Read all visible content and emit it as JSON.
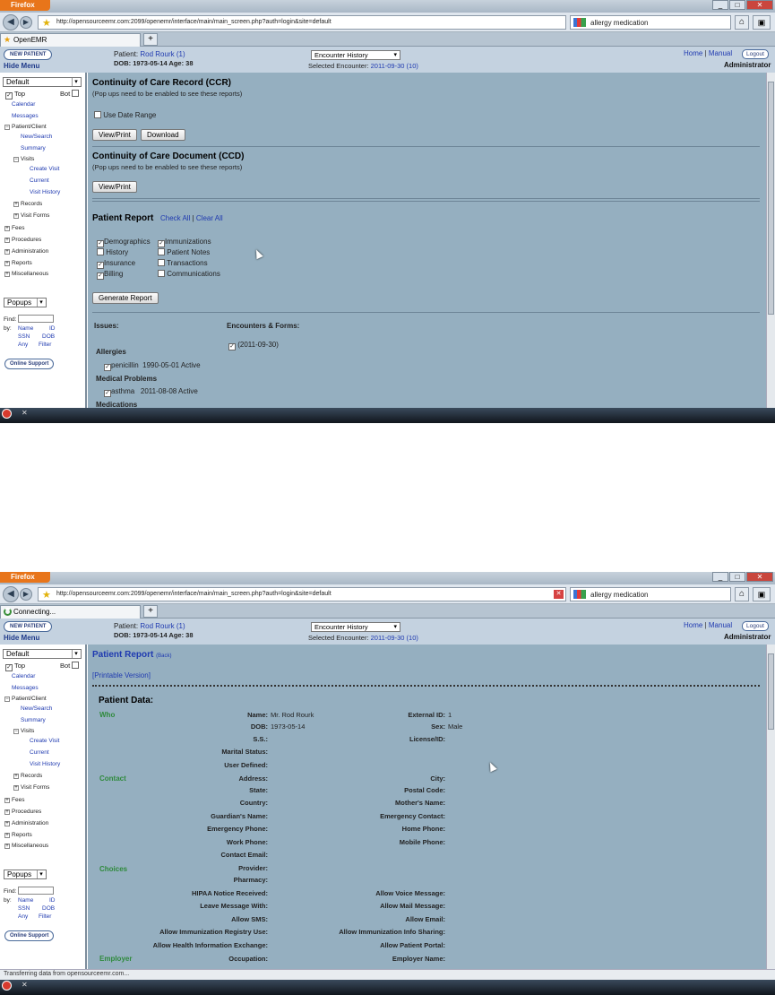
{
  "browser": {
    "menu_label": "Firefox",
    "url": "http://opensourceemr.com:2099/openemr/interface/main/main_screen.php?auth=login&site=default",
    "search_text": "allergy medication",
    "tab_label_1": "OpenEMR",
    "tab_label_2": "Connecting...",
    "new_tab": "+",
    "win_min": "_",
    "win_max": "□",
    "win_close": "✕",
    "status_text": "Transferring data from opensourceemr.com..."
  },
  "header": {
    "new_patient": "NEW PATIENT",
    "hide_menu": "Hide Menu",
    "patient_label": "Patient:",
    "patient_name": "Rod Rourk (1)",
    "dob_line": "DOB: 1973-05-14 Age: 38",
    "encounter_history": "Encounter History",
    "selected_encounter_label": "Selected Encounter:",
    "selected_encounter": "2011-09-30 (10)",
    "home": "Home",
    "manual": "Manual",
    "sep": "|",
    "logout": "Logout",
    "user": "Administrator"
  },
  "sidebar": {
    "select_default": "Default",
    "top": "Top",
    "bot": "Bot",
    "calendar": "Calendar",
    "messages": "Messages",
    "patient_client": "Patient/Client",
    "new_search": "New/Search",
    "summary": "Summary",
    "visits": "Visits",
    "create_visit": "Create Visit",
    "current": "Current",
    "visit_history": "Visit History",
    "records": "Records",
    "visit_forms": "Visit Forms",
    "fees": "Fees",
    "procedures": "Procedures",
    "administration": "Administration",
    "reports": "Reports",
    "miscellaneous": "Miscellaneous",
    "popups": "Popups",
    "find": "Find:",
    "by": "by:",
    "name": "Name",
    "id": "ID",
    "ssn": "SSN",
    "dob": "DOB",
    "any": "Any",
    "filter": "Filter",
    "online_support": "Online Support"
  },
  "reports_page": {
    "ccr_title": "Continuity of Care Record (CCR)",
    "ccr_note": "(Pop ups need to be enabled to see these reports)",
    "use_date_range": "Use Date Range",
    "view_print": "View/Print",
    "download": "Download",
    "ccd_title": "Continuity of Care Document (CCD)",
    "ccd_note": "(Pop ups need to be enabled to see these reports)",
    "patient_report": "Patient Report",
    "check_all": "Check All",
    "clear_all": "Clear All",
    "opts": {
      "demographics": "Demographics",
      "immunizations": "Immunizations",
      "history": "History",
      "patient_notes": "Patient Notes",
      "insurance": "Insurance",
      "transactions": "Transactions",
      "billing": "Billing",
      "communications": "Communications"
    },
    "generate_report": "Generate Report",
    "issues": "Issues:",
    "encounters_forms": "Encounters & Forms:",
    "encounter_item": "(2011-09-30)",
    "allergies": "Allergies",
    "allergy_item": "penicillin",
    "allergy_date": "1990-05-01 Active",
    "medical_problems": "Medical Problems",
    "problem_item": "asthma",
    "problem_date": "2011-08-08 Active",
    "medications": "Medications"
  },
  "patient_report": {
    "title": "Patient Report",
    "back": "(Back)",
    "printable": "[Printable Version]",
    "patient_data": "Patient Data:",
    "sections": {
      "who": "Who",
      "contact": "Contact",
      "choices": "Choices",
      "employer": "Employer"
    },
    "left_labels": [
      "Name:",
      "DOB:",
      "S.S.:",
      "Marital Status:",
      "User Defined:",
      "Address:",
      "State:",
      "Country:",
      "Guardian's Name:",
      "Emergency Phone:",
      "Work Phone:",
      "Contact Email:",
      "Provider:",
      "Pharmacy:",
      "HIPAA Notice Received:",
      "Leave Message With:",
      "Allow SMS:",
      "Allow Immunization Registry Use:",
      "Allow Health Information Exchange:",
      "Occupation:"
    ],
    "name_value": "Mr. Rod  Rourk",
    "dob_value": "1973-05-14",
    "right_labels": [
      "External ID:",
      "Sex:",
      "License/ID:",
      "City:",
      "Postal Code:",
      "Mother's Name:",
      "Emergency Contact:",
      "Home Phone:",
      "Mobile Phone:",
      "Allow Voice Message:",
      "Allow Mail Message:",
      "Allow Email:",
      "Allow Immunization Info Sharing:",
      "Allow Patient Portal:",
      "Employer Name:"
    ],
    "external_id_value": "1",
    "sex_value": "Male"
  }
}
